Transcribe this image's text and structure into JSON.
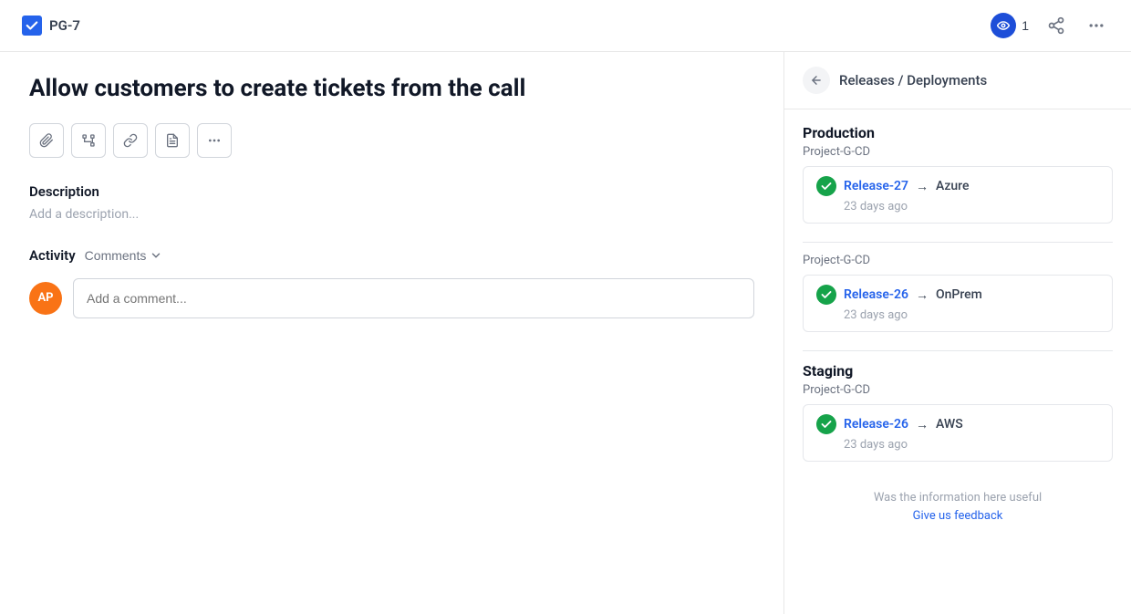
{
  "header": {
    "ticket_id": "PG-7",
    "watch_count": "1",
    "back_label": "Releases / Deployments"
  },
  "issue": {
    "title": "Allow customers to create tickets from the call",
    "description_label": "Description",
    "description_placeholder": "Add a description..."
  },
  "toolbar": {
    "buttons": [
      "attachment",
      "hierarchy",
      "link",
      "document",
      "more"
    ]
  },
  "activity": {
    "label": "Activity",
    "comments_label": "Comments",
    "avatar_initials": "AP",
    "comment_placeholder": "Add a comment..."
  },
  "right_panel": {
    "title": "Releases / Deployments",
    "environments": [
      {
        "name": "Production",
        "pipeline": "Project-G-CD",
        "releases": [
          {
            "name": "Release-27",
            "arrow": "→",
            "target": "Azure",
            "time": "23 days ago"
          }
        ]
      },
      {
        "name": "",
        "pipeline": "Project-G-CD",
        "releases": [
          {
            "name": "Release-26",
            "arrow": "→",
            "target": "OnPrem",
            "time": "23 days ago"
          }
        ]
      },
      {
        "name": "Staging",
        "pipeline": "Project-G-CD",
        "releases": [
          {
            "name": "Release-26",
            "arrow": "→",
            "target": "AWS",
            "time": "23 days ago"
          }
        ]
      }
    ],
    "feedback_text": "Was the information here useful",
    "feedback_link": "Give us feedback"
  }
}
